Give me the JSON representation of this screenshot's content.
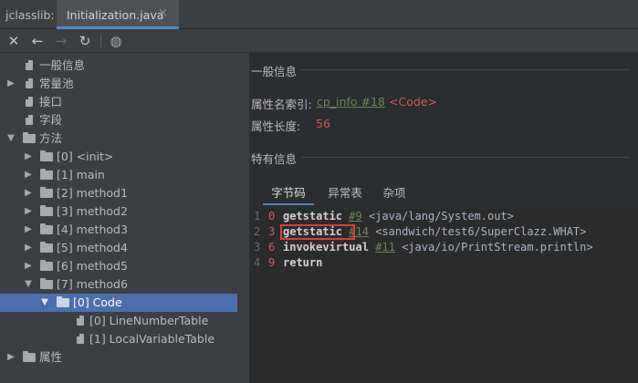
{
  "window": {
    "tool_title": "jclasslib:",
    "tab_label": "Initialization.java",
    "tab_close": "×"
  },
  "toolbar": {
    "icons": [
      "close-icon",
      "back-icon",
      "forward-icon",
      "refresh-icon",
      "globe-icon"
    ],
    "glyphs": [
      "✕",
      "←",
      "→",
      "↻",
      "◍"
    ]
  },
  "tree": {
    "general": "一般信息",
    "constant_pool": "常量池",
    "interfaces": "接口",
    "fields": "字段",
    "methods": "方法",
    "method_items": [
      "[0] <init>",
      "[1] main",
      "[2] method1",
      "[3] method2",
      "[4] method3",
      "[5] method4",
      "[6] method5",
      "[7] method6"
    ],
    "code": "[0] Code",
    "line_number_table": "[0] LineNumberTable",
    "local_variable_table": "[1] LocalVariableTable",
    "attributes": "属性"
  },
  "general_info": {
    "title": "一般信息",
    "name_index_label": "属性名索引:",
    "name_index_link": "cp_info #18",
    "name_index_value": "<Code>",
    "length_label": "属性长度:",
    "length_value": "56"
  },
  "specific_info": {
    "title": "特有信息",
    "tabs": [
      "字节码",
      "异常表",
      "杂项"
    ],
    "active_tab": "字节码"
  },
  "bytecode": [
    {
      "line": "1",
      "offset": "0",
      "op": "getstatic",
      "ref": "#9",
      "comment": "<java/lang/System.out>"
    },
    {
      "line": "2",
      "offset": "3",
      "op": "getstatic",
      "ref": "#14",
      "comment": "<sandwich/test6/SuperClazz.WHAT>"
    },
    {
      "line": "3",
      "offset": "6",
      "op": "invokevirtual",
      "ref": "#11",
      "comment": "<java/io/PrintStream.println>"
    },
    {
      "line": "4",
      "offset": "9",
      "op": "return",
      "ref": "",
      "comment": ""
    }
  ],
  "colors": {
    "accent": "#4a88c7",
    "selection": "#4b6eaf",
    "link_green": "#6a8759",
    "offset_red": "#cc5c5c",
    "highlight_box": "#e03b3b"
  }
}
